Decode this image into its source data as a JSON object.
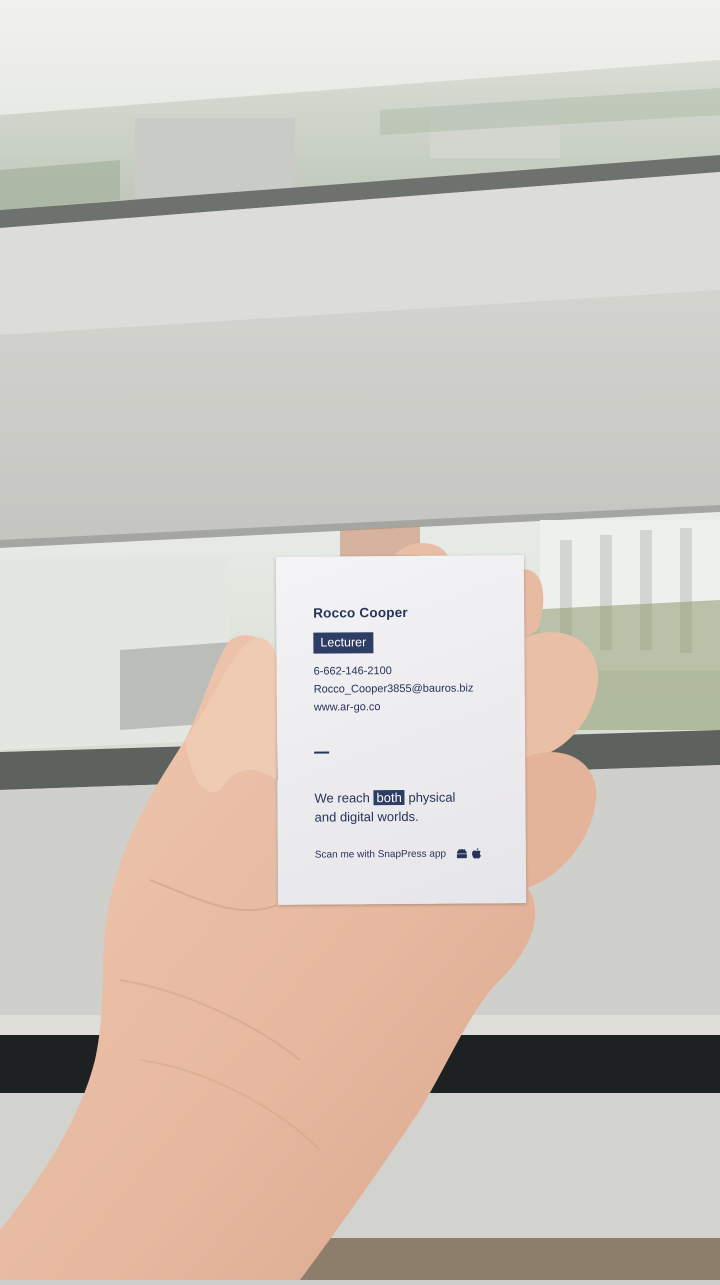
{
  "card": {
    "name": "Rocco Cooper",
    "title": "Lecturer",
    "phone": "6-662-146-2100",
    "email": "Rocco_Cooper3855@bauros.biz",
    "website": "www.ar-go.co",
    "tagline": {
      "before": "We reach",
      "highlight": "both",
      "after": "physical",
      "line2": "and digital worlds."
    },
    "scan_text": "Scan me with SnapPress app",
    "icons": [
      "android-icon",
      "apple-icon"
    ],
    "accent_color": "#2e3d66"
  }
}
